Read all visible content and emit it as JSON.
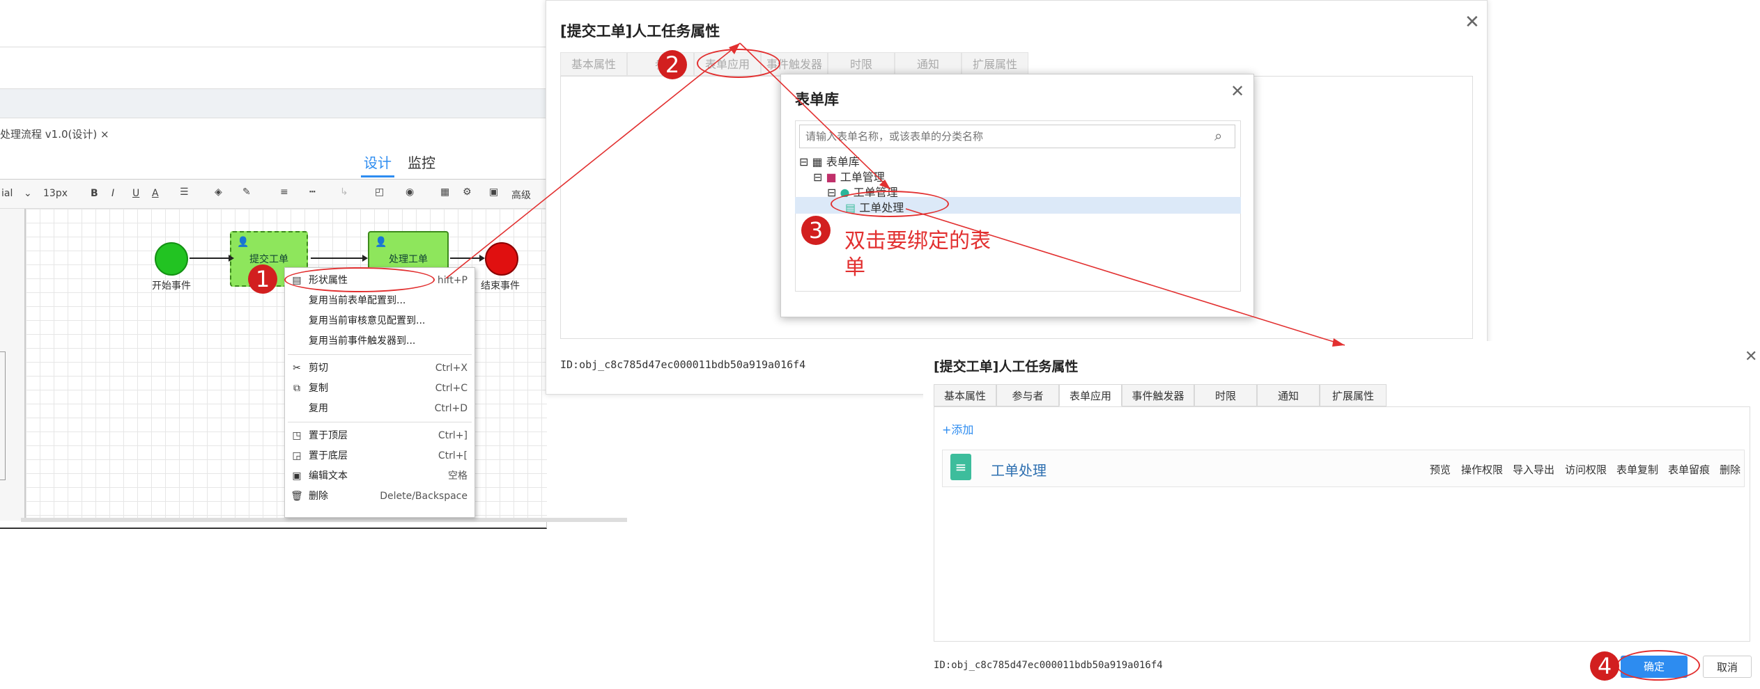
{
  "editor": {
    "doc_tab": "处理流程 v1.0(设计) ×",
    "tabs": {
      "design": "设计",
      "monitor": "监控"
    },
    "toolbar": {
      "font": "ial",
      "size": "13px",
      "bold": "B",
      "italic": "I",
      "underline": "U",
      "font_color": "A",
      "advanced": "高级"
    },
    "nodes": {
      "start": "开始事件",
      "submit": "提交工单",
      "process": "处理工单",
      "end": "结束事件"
    }
  },
  "context_menu": {
    "items": [
      {
        "label": "形状属性",
        "shortcut": "hift+P",
        "icon": "shape-props-icon"
      },
      {
        "label": "复用当前表单配置到...",
        "shortcut": ""
      },
      {
        "label": "复用当前审核意见配置到...",
        "shortcut": ""
      },
      {
        "label": "复用当前事件触发器到...",
        "shortcut": ""
      },
      {
        "label": "剪切",
        "shortcut": "Ctrl+X",
        "icon": "scissors-icon"
      },
      {
        "label": "复制",
        "shortcut": "Ctrl+C",
        "icon": "copy-icon"
      },
      {
        "label": "复用",
        "shortcut": "Ctrl+D"
      },
      {
        "label": "置于顶层",
        "shortcut": "Ctrl+]",
        "icon": "bring-front-icon"
      },
      {
        "label": "置于底层",
        "shortcut": "Ctrl+[",
        "icon": "send-back-icon"
      },
      {
        "label": "编辑文本",
        "shortcut": "空格",
        "icon": "edit-text-icon"
      },
      {
        "label": "删除",
        "shortcut": "Delete/Backspace",
        "icon": "trash-icon"
      }
    ]
  },
  "dialog1": {
    "title": "[提交工单]人工任务属性",
    "tabs": [
      "基本属性",
      "参",
      "表单应用",
      "事件触发器",
      "时限",
      "通知",
      "扩展属性"
    ],
    "id_text": "ID:obj_c8c785d47ec000011bdb50a919a016f4"
  },
  "form_library": {
    "title": "表单库",
    "search_placeholder": "请输入表单名称，或该表单的分类名称",
    "tree": {
      "root": "表单库",
      "group": "工单管理",
      "subgroup": "工单管理",
      "form": "工单处理"
    }
  },
  "dialog2": {
    "title": "[提交工单]人工任务属性",
    "tabs": [
      "基本属性",
      "参与者",
      "表单应用",
      "事件触发器",
      "时限",
      "通知",
      "扩展属性"
    ],
    "add_label": "+添加",
    "form_name": "工单处理",
    "actions": [
      "预览",
      "操作权限",
      "导入导出",
      "访问权限",
      "表单复制",
      "表单留痕",
      "删除"
    ],
    "id_text": "ID:obj_c8c785d47ec000011bdb50a919a016f4",
    "ok_label": "确定",
    "cancel_label": "取消"
  },
  "annotations": {
    "step1": "1",
    "step2": "2",
    "step3": "3",
    "step4": "4",
    "step3_text_line1": "双击要绑定的表",
    "step3_text_line2": "单"
  },
  "colors": {
    "accent": "#2d8cf0",
    "annotation_red": "#d21f1f",
    "task_green": "#8ee65c"
  }
}
